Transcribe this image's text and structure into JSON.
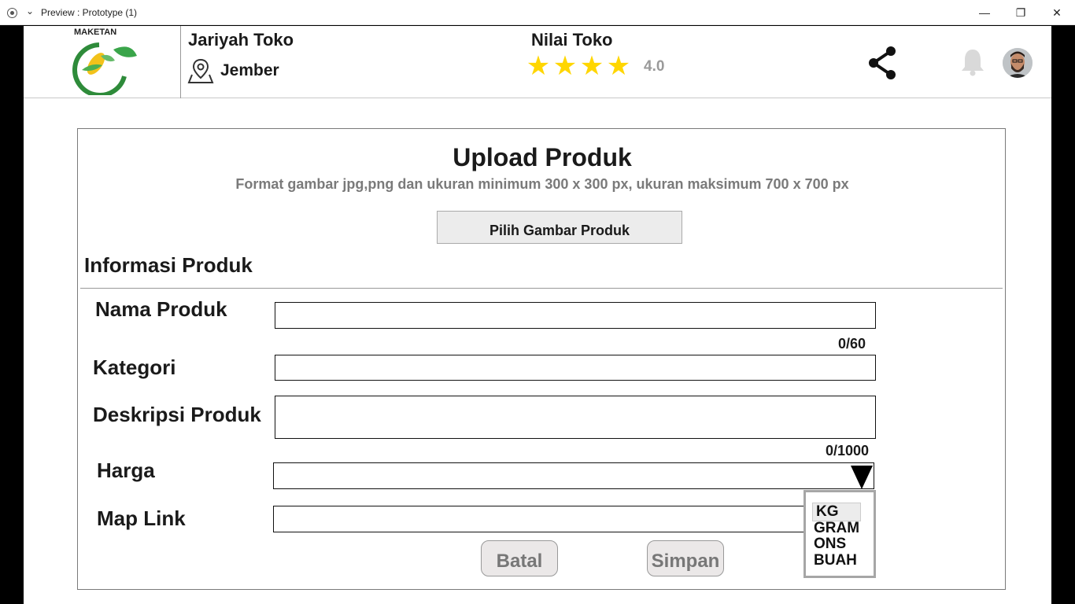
{
  "window": {
    "title": "Preview : Prototype (1)",
    "minimize": "—",
    "restore": "❐",
    "close": "✕"
  },
  "header": {
    "logo_text": "MAKETAN",
    "store_name": "Jariyah Toko",
    "location": "Jember",
    "rating_title": "Nilai Toko",
    "rating_value": "4.0",
    "stars": 4,
    "colors": {
      "star": "#ffd600",
      "logo_green": "#2e8b3a"
    }
  },
  "form": {
    "title": "Upload Produk",
    "subtitle": "Format gambar jpg,png dan ukuran minimum 300 x 300 px, ukuran maksimum 700 x 700 px",
    "pick_image_label": "Pilih Gambar Produk",
    "section_title": "Informasi Produk",
    "fields": {
      "name_label": "Nama Produk",
      "name_counter": "0/60",
      "category_label": "Kategori",
      "description_label": "Deskripsi Produk",
      "description_counter": "0/1000",
      "price_label": "Harga",
      "map_label": "Map Link"
    },
    "unit_options": [
      "KG",
      "GRAM",
      "ONS",
      "BUAH"
    ],
    "cancel_label": "Batal",
    "save_label": "Simpan"
  }
}
